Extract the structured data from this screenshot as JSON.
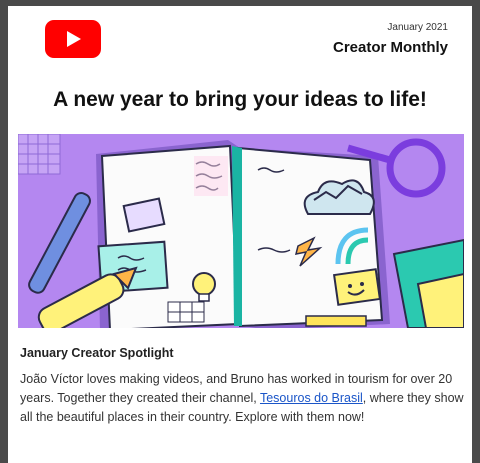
{
  "header": {
    "date": "January 2021",
    "brand": "Creator Monthly",
    "logo_icon": "play-icon",
    "logo_color": "#ff0000"
  },
  "headline": "A new year to bring your ideas to life!",
  "hero": {
    "illustration": "notebook-illustration",
    "background_color": "#b487f0"
  },
  "spotlight": {
    "title": "January Creator Spotlight",
    "text_before": "João Víctor loves making videos, and Bruno has worked in tourism for over 20 years. Together they created their channel,",
    "link_text": "Tesouros do Brasil",
    "text_after": ", where they show all the beautiful places in their country. Explore with them now!",
    "link_color": "#1a55c8"
  }
}
